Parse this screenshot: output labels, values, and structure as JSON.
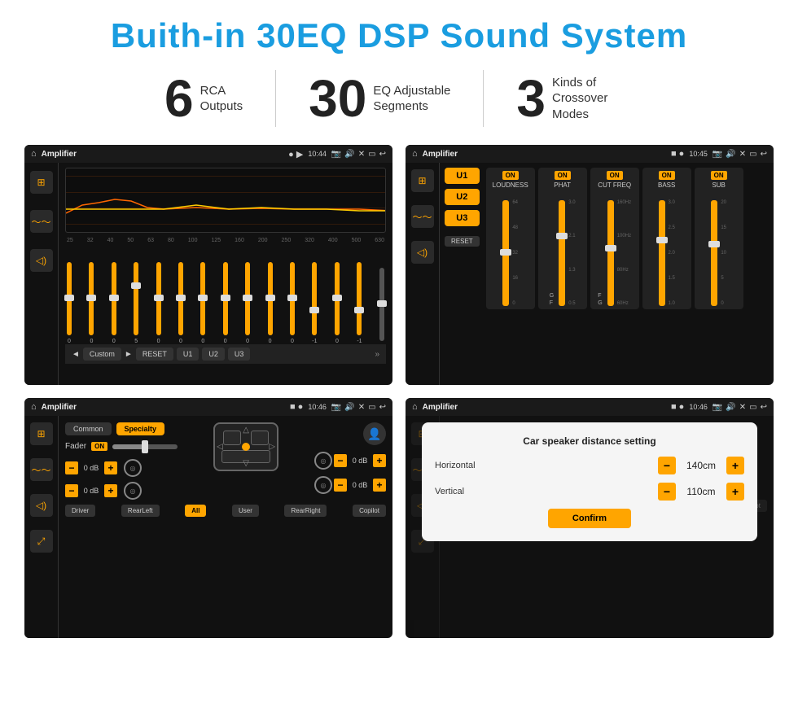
{
  "header": {
    "title": "Buith-in 30EQ DSP Sound System"
  },
  "stats": [
    {
      "number": "6",
      "label": "RCA\nOutputs"
    },
    {
      "number": "30",
      "label": "EQ Adjustable\nSegments"
    },
    {
      "number": "3",
      "label": "Kinds of\nCrossover Modes"
    }
  ],
  "screens": {
    "eq": {
      "title": "Amplifier",
      "time": "10:44",
      "freqs": [
        "25",
        "32",
        "40",
        "50",
        "63",
        "80",
        "100",
        "125",
        "160",
        "200",
        "250",
        "320",
        "400",
        "500",
        "630"
      ],
      "vals": [
        "0",
        "0",
        "0",
        "5",
        "0",
        "0",
        "0",
        "0",
        "0",
        "0",
        "0",
        "-1",
        "0",
        "-1",
        ""
      ],
      "buttons": [
        "Custom",
        "RESET",
        "U1",
        "U2",
        "U3"
      ]
    },
    "crossover": {
      "title": "Amplifier",
      "time": "10:45",
      "units": [
        "U1",
        "U2",
        "U3"
      ],
      "cols": [
        "LOUDNESS",
        "PHAT",
        "CUT FREQ",
        "BASS",
        "SUB"
      ]
    },
    "fader": {
      "title": "Amplifier",
      "time": "10:46",
      "tabs": [
        "Common",
        "Specialty"
      ],
      "fader_label": "Fader",
      "on_label": "ON",
      "bottom_buttons": [
        "Driver",
        "RearLeft",
        "All",
        "User",
        "RearRight",
        "Copilot"
      ]
    },
    "distance": {
      "title": "Amplifier",
      "time": "10:46",
      "dialog_title": "Car speaker distance setting",
      "horizontal_label": "Horizontal",
      "horizontal_value": "140cm",
      "vertical_label": "Vertical",
      "vertical_value": "110cm",
      "confirm_label": "Confirm"
    }
  },
  "icons": {
    "home": "⌂",
    "equalizer": "≡",
    "waveform": "〜",
    "speaker": "◁",
    "location": "⊙",
    "camera": "◻",
    "volume": "♪",
    "back": "↩",
    "person": "👤",
    "settings": "⚙"
  }
}
